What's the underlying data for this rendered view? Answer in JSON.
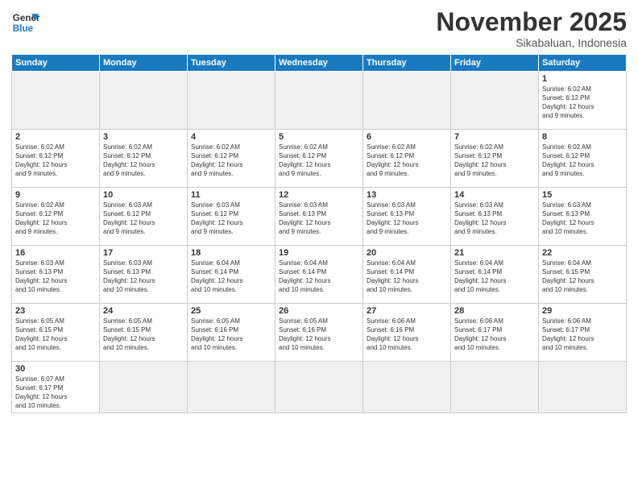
{
  "header": {
    "logo_general": "General",
    "logo_blue": "Blue",
    "month_title": "November 2025",
    "subtitle": "Sikabaluan, Indonesia"
  },
  "days_of_week": [
    "Sunday",
    "Monday",
    "Tuesday",
    "Wednesday",
    "Thursday",
    "Friday",
    "Saturday"
  ],
  "weeks": [
    [
      {
        "day": "",
        "info": "",
        "empty": true
      },
      {
        "day": "",
        "info": "",
        "empty": true
      },
      {
        "day": "",
        "info": "",
        "empty": true
      },
      {
        "day": "",
        "info": "",
        "empty": true
      },
      {
        "day": "",
        "info": "",
        "empty": true
      },
      {
        "day": "",
        "info": "",
        "empty": true
      },
      {
        "day": "1",
        "info": "Sunrise: 6:02 AM\nSunset: 6:12 PM\nDaylight: 12 hours\nand 9 minutes.",
        "empty": false
      }
    ],
    [
      {
        "day": "2",
        "info": "Sunrise: 6:02 AM\nSunset: 6:12 PM\nDaylight: 12 hours\nand 9 minutes.",
        "empty": false
      },
      {
        "day": "3",
        "info": "Sunrise: 6:02 AM\nSunset: 6:12 PM\nDaylight: 12 hours\nand 9 minutes.",
        "empty": false
      },
      {
        "day": "4",
        "info": "Sunrise: 6:02 AM\nSunset: 6:12 PM\nDaylight: 12 hours\nand 9 minutes.",
        "empty": false
      },
      {
        "day": "5",
        "info": "Sunrise: 6:02 AM\nSunset: 6:12 PM\nDaylight: 12 hours\nand 9 minutes.",
        "empty": false
      },
      {
        "day": "6",
        "info": "Sunrise: 6:02 AM\nSunset: 6:12 PM\nDaylight: 12 hours\nand 9 minutes.",
        "empty": false
      },
      {
        "day": "7",
        "info": "Sunrise: 6:02 AM\nSunset: 6:12 PM\nDaylight: 12 hours\nand 9 minutes.",
        "empty": false
      },
      {
        "day": "8",
        "info": "Sunrise: 6:02 AM\nSunset: 6:12 PM\nDaylight: 12 hours\nand 9 minutes.",
        "empty": false
      }
    ],
    [
      {
        "day": "9",
        "info": "Sunrise: 6:02 AM\nSunset: 6:12 PM\nDaylight: 12 hours\nand 9 minutes.",
        "empty": false
      },
      {
        "day": "10",
        "info": "Sunrise: 6:03 AM\nSunset: 6:12 PM\nDaylight: 12 hours\nand 9 minutes.",
        "empty": false
      },
      {
        "day": "11",
        "info": "Sunrise: 6:03 AM\nSunset: 6:12 PM\nDaylight: 12 hours\nand 9 minutes.",
        "empty": false
      },
      {
        "day": "12",
        "info": "Sunrise: 6:03 AM\nSunset: 6:13 PM\nDaylight: 12 hours\nand 9 minutes.",
        "empty": false
      },
      {
        "day": "13",
        "info": "Sunrise: 6:03 AM\nSunset: 6:13 PM\nDaylight: 12 hours\nand 9 minutes.",
        "empty": false
      },
      {
        "day": "14",
        "info": "Sunrise: 6:03 AM\nSunset: 6:13 PM\nDaylight: 12 hours\nand 9 minutes.",
        "empty": false
      },
      {
        "day": "15",
        "info": "Sunrise: 6:03 AM\nSunset: 6:13 PM\nDaylight: 12 hours\nand 10 minutes.",
        "empty": false
      }
    ],
    [
      {
        "day": "16",
        "info": "Sunrise: 6:03 AM\nSunset: 6:13 PM\nDaylight: 12 hours\nand 10 minutes.",
        "empty": false
      },
      {
        "day": "17",
        "info": "Sunrise: 6:03 AM\nSunset: 6:13 PM\nDaylight: 12 hours\nand 10 minutes.",
        "empty": false
      },
      {
        "day": "18",
        "info": "Sunrise: 6:04 AM\nSunset: 6:14 PM\nDaylight: 12 hours\nand 10 minutes.",
        "empty": false
      },
      {
        "day": "19",
        "info": "Sunrise: 6:04 AM\nSunset: 6:14 PM\nDaylight: 12 hours\nand 10 minutes.",
        "empty": false
      },
      {
        "day": "20",
        "info": "Sunrise: 6:04 AM\nSunset: 6:14 PM\nDaylight: 12 hours\nand 10 minutes.",
        "empty": false
      },
      {
        "day": "21",
        "info": "Sunrise: 6:04 AM\nSunset: 6:14 PM\nDaylight: 12 hours\nand 10 minutes.",
        "empty": false
      },
      {
        "day": "22",
        "info": "Sunrise: 6:04 AM\nSunset: 6:15 PM\nDaylight: 12 hours\nand 10 minutes.",
        "empty": false
      }
    ],
    [
      {
        "day": "23",
        "info": "Sunrise: 6:05 AM\nSunset: 6:15 PM\nDaylight: 12 hours\nand 10 minutes.",
        "empty": false
      },
      {
        "day": "24",
        "info": "Sunrise: 6:05 AM\nSunset: 6:15 PM\nDaylight: 12 hours\nand 10 minutes.",
        "empty": false
      },
      {
        "day": "25",
        "info": "Sunrise: 6:05 AM\nSunset: 6:16 PM\nDaylight: 12 hours\nand 10 minutes.",
        "empty": false
      },
      {
        "day": "26",
        "info": "Sunrise: 6:05 AM\nSunset: 6:16 PM\nDaylight: 12 hours\nand 10 minutes.",
        "empty": false
      },
      {
        "day": "27",
        "info": "Sunrise: 6:06 AM\nSunset: 6:16 PM\nDaylight: 12 hours\nand 10 minutes.",
        "empty": false
      },
      {
        "day": "28",
        "info": "Sunrise: 6:06 AM\nSunset: 6:17 PM\nDaylight: 12 hours\nand 10 minutes.",
        "empty": false
      },
      {
        "day": "29",
        "info": "Sunrise: 6:06 AM\nSunset: 6:17 PM\nDaylight: 12 hours\nand 10 minutes.",
        "empty": false
      }
    ],
    [
      {
        "day": "30",
        "info": "Sunrise: 6:07 AM\nSunset: 6:17 PM\nDaylight: 12 hours\nand 10 minutes.",
        "empty": false
      },
      {
        "day": "",
        "info": "",
        "empty": true
      },
      {
        "day": "",
        "info": "",
        "empty": true
      },
      {
        "day": "",
        "info": "",
        "empty": true
      },
      {
        "day": "",
        "info": "",
        "empty": true
      },
      {
        "day": "",
        "info": "",
        "empty": true
      },
      {
        "day": "",
        "info": "",
        "empty": true
      }
    ]
  ]
}
